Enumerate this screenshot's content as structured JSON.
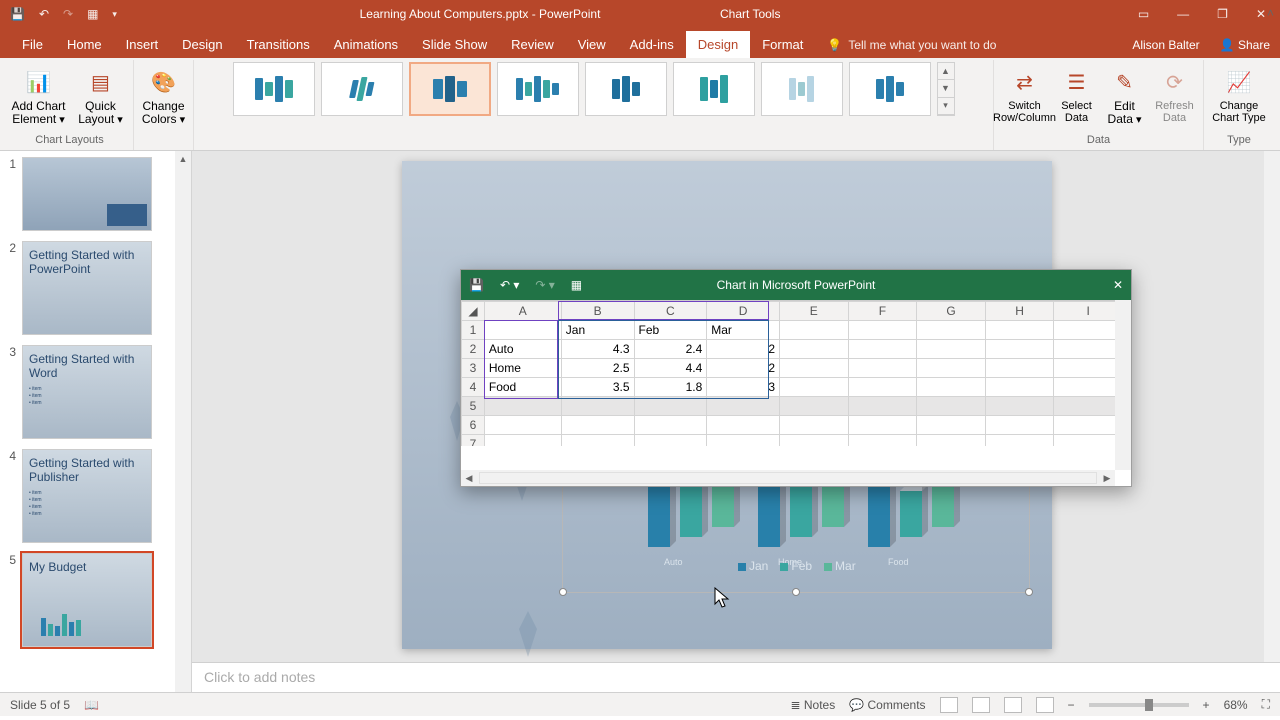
{
  "chart_data": {
    "type": "bar",
    "categories": [
      "Auto",
      "Home",
      "Food"
    ],
    "series": [
      {
        "name": "Jan",
        "values": [
          4.3,
          2.5,
          3.5
        ]
      },
      {
        "name": "Feb",
        "values": [
          2.4,
          4.4,
          1.8
        ]
      },
      {
        "name": "Mar",
        "values": [
          2,
          2,
          3
        ]
      }
    ],
    "xlabel": "",
    "ylabel": "",
    "title": ""
  },
  "app": {
    "title": "Learning About Computers.pptx - PowerPoint",
    "context_tab_title": "Chart Tools",
    "user_name": "Alison Balter",
    "share": "Share"
  },
  "tabs": {
    "items": [
      "File",
      "Home",
      "Insert",
      "Design",
      "Transitions",
      "Animations",
      "Slide Show",
      "Review",
      "View",
      "Add-ins",
      "Design",
      "Format"
    ],
    "active_index": 10,
    "tell_me": "Tell me what you want to do"
  },
  "ribbon": {
    "add_chart_element": "Add Chart Element",
    "quick_layout": "Quick Layout",
    "chart_layouts_group": "Chart Layouts",
    "change_colors": "Change Colors",
    "switch_row_col": "Switch Row/Column",
    "select_data": "Select Data",
    "edit_data": "Edit Data",
    "refresh_data": "Refresh Data",
    "data_group": "Data",
    "change_chart_type": "Change Chart Type",
    "type_group": "Type"
  },
  "thumbs": {
    "items": [
      {
        "n": "1",
        "title": ""
      },
      {
        "n": "2",
        "title": "Getting Started with PowerPoint"
      },
      {
        "n": "3",
        "title": "Getting Started with Word"
      },
      {
        "n": "4",
        "title": "Getting Started with Publisher"
      },
      {
        "n": "5",
        "title": "My Budget"
      }
    ],
    "selected": 4
  },
  "excel": {
    "title": "Chart in Microsoft PowerPoint",
    "cols": [
      "A",
      "B",
      "C",
      "D",
      "E",
      "F",
      "G",
      "H",
      "I"
    ],
    "rows": [
      "1",
      "2",
      "3",
      "4",
      "5",
      "6",
      "7"
    ],
    "header_row": [
      "",
      "Jan",
      "Feb",
      "Mar"
    ],
    "data": [
      [
        "Auto",
        "4.3",
        "2.4",
        "2"
      ],
      [
        "Home",
        "2.5",
        "4.4",
        "2"
      ],
      [
        "Food",
        "3.5",
        "1.8",
        "3"
      ]
    ]
  },
  "notes": {
    "placeholder": "Click to add notes"
  },
  "status": {
    "slide_info": "Slide 5 of 5",
    "notes": "Notes",
    "comments": "Comments",
    "zoom": "68%"
  },
  "chart_side": {
    "plus": "+",
    "brush": "✎",
    "filter": "▼"
  },
  "legend": {
    "jan": "Jan",
    "feb": "Feb",
    "mar": "Mar"
  },
  "axis": {
    "auto": "Auto",
    "home": "Home",
    "food": "Food"
  }
}
